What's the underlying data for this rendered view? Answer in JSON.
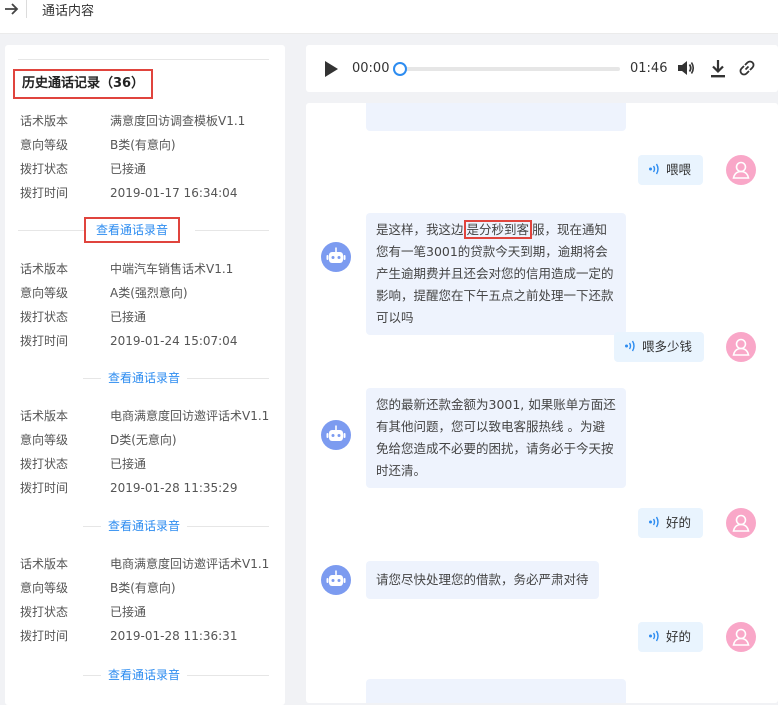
{
  "header": {
    "title": "通话内容",
    "back_icon": "arrow-right-icon"
  },
  "history": {
    "title": "历史通话记录（36）",
    "view_label": "查看通话录音",
    "labels": {
      "version": "话术版本",
      "intent": "意向等级",
      "status": "拨打状态",
      "time": "拨打时间"
    },
    "records": [
      {
        "version": "满意度回访调查模板V1.1",
        "intent": "B类(有意向)",
        "status": "已接通",
        "time": "2019-01-17 16:34:04"
      },
      {
        "version": "中端汽车销售话术V1.1",
        "intent": "A类(强烈意向)",
        "status": "已接通",
        "time": "2019-01-24 15:07:04"
      },
      {
        "version": "电商满意度回访邀评话术V1.1",
        "intent": "D类(无意向)",
        "status": "已接通",
        "time": "2019-01-28 11:35:29"
      },
      {
        "version": "电商满意度回访邀评话术V1.1",
        "intent": "B类(有意向)",
        "status": "已接通",
        "time": "2019-01-28 11:36:31"
      }
    ]
  },
  "player": {
    "current": "00:00",
    "total": "01:46",
    "progress": 0
  },
  "chat": {
    "messages": [
      {
        "role": "user",
        "text": "喂喂"
      },
      {
        "role": "bot",
        "before": "是这样，我这边",
        "highlight": "是分秒到客",
        "after": "服，现在通知您有一笔3001的贷款今天到期，逾期将会产生逾期费并且还会对您的信用造成一定的影响，提醒您在下午五点之前处理一下还款可以吗"
      },
      {
        "role": "user",
        "text": "喂多少钱"
      },
      {
        "role": "bot",
        "text": "您的最新还款金额为3001, 如果账单方面还有其他问题，您可以致电客服热线 。为避免给您造成不必要的困扰，请务必于今天按时还清。"
      },
      {
        "role": "user",
        "text": "好的"
      },
      {
        "role": "bot",
        "text": "请您尽快处理您的借款，务必严肃对待"
      },
      {
        "role": "user",
        "text": "好的"
      }
    ]
  },
  "colors": {
    "accent": "#2d8cf0",
    "highlight": "#e0443d",
    "bot_avatar": "#7c9bf0",
    "user_avatar": "#f9a7c8"
  }
}
